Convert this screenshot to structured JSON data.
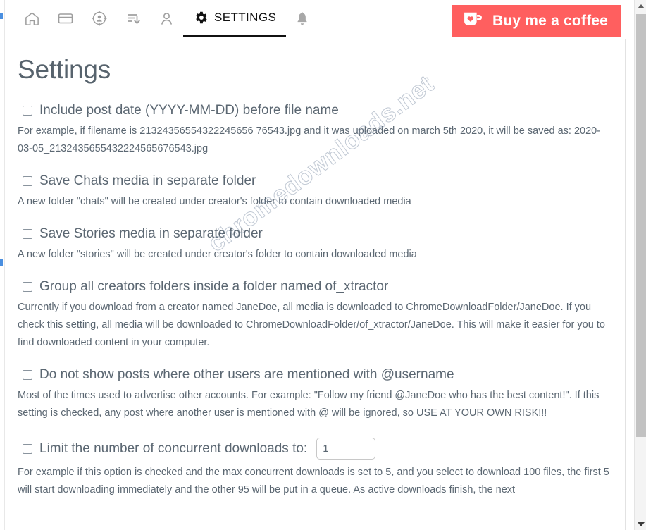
{
  "window": {
    "scrollbar": {
      "up_arrow": "scroll-up",
      "down_arrow": "scroll-down"
    }
  },
  "navbar": {
    "items": [
      {
        "icon": "home-icon",
        "label": "",
        "active": false
      },
      {
        "icon": "credit-card-icon",
        "label": "",
        "active": false
      },
      {
        "icon": "target-user-icon",
        "label": "",
        "active": false
      },
      {
        "icon": "download-list-icon",
        "label": "",
        "active": false
      },
      {
        "icon": "person-icon",
        "label": "",
        "active": false
      },
      {
        "icon": "gear-icon",
        "label": "SETTINGS",
        "active": true
      },
      {
        "icon": "bell-icon",
        "label": "",
        "active": false
      }
    ],
    "settings_label": "SETTINGS",
    "coffee": {
      "label": "Buy me a coffee",
      "icon": "coffee-cup-heart-icon",
      "background": "#ff5f5f",
      "text_color": "#ffffff"
    }
  },
  "watermark": {
    "text": "chromedownloads.net"
  },
  "page": {
    "title": "Settings",
    "title_color": "#57636d",
    "text_color": "#5b6772"
  },
  "options": [
    {
      "label": "Include post date (YYYY-MM-DD) before file name",
      "checked": false,
      "description": "For example, if filename is 21324356554322245656 76543.jpg and it was uploaded on march 5th 2020, it will be saved as: 2020-03-05_2132435655432224565676543.jpg"
    },
    {
      "label": "Save Chats media in separate folder",
      "checked": false,
      "description": "A new folder \"chats\" will be created under creator's folder to contain downloaded media"
    },
    {
      "label": "Save Stories media in separate folder",
      "checked": false,
      "description": "A new folder \"stories\" will be created under creator's folder to contain downloaded media"
    },
    {
      "label": "Group all creators folders inside a folder named of_xtractor",
      "checked": false,
      "description": "Currently if you download from a creator named JaneDoe, all media is downloaded to ChromeDownloadFolder/JaneDoe. If you check this setting, all media will be downloaded to ChromeDownloadFolder/of_xtractor/JaneDoe. This will make it easier for you to find downloaded content in your computer."
    },
    {
      "label": "Do not show posts where other users are mentioned with @username",
      "checked": false,
      "description": "Most of the times used to advertise other accounts. For example: \"Follow my friend @JaneDoe who has the best content!\". If this setting is checked, any post where another user is mentioned with @ will be ignored, so USE AT YOUR OWN RISK!!!"
    },
    {
      "label": "Limit the number of concurrent downloads to:",
      "checked": false,
      "input_value": "1",
      "description": "For example if this option is checked and the max concurrent downloads is set to 5, and you select to download 100 files, the first 5 will start downloading immediately and the other 95 will be put in a queue. As active downloads finish, the next"
    }
  ]
}
